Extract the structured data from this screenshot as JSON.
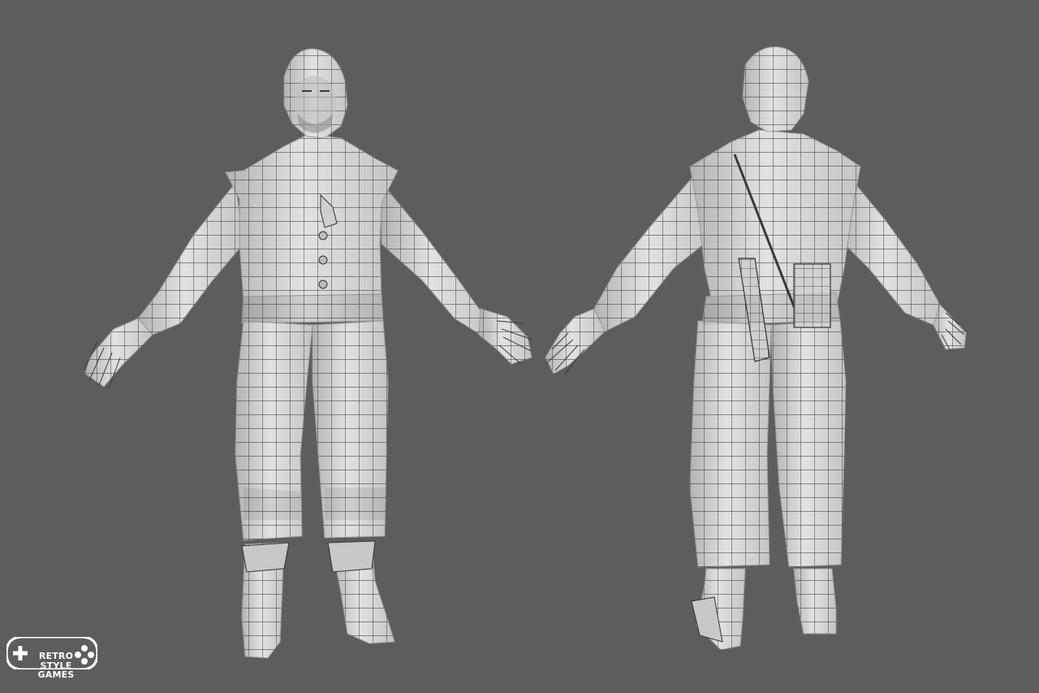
{
  "scene": {
    "background": "#5d5d5e",
    "model_fill": "#d9d9d9",
    "model_shade": "#a9a9a9",
    "wire_color": "#2a2a2a",
    "views": [
      {
        "name": "front-view"
      },
      {
        "name": "back-view"
      }
    ]
  },
  "watermark": {
    "line1": "RETRO",
    "line2": "STYLE",
    "line3": "GAMES",
    "color": "#ffffff"
  }
}
